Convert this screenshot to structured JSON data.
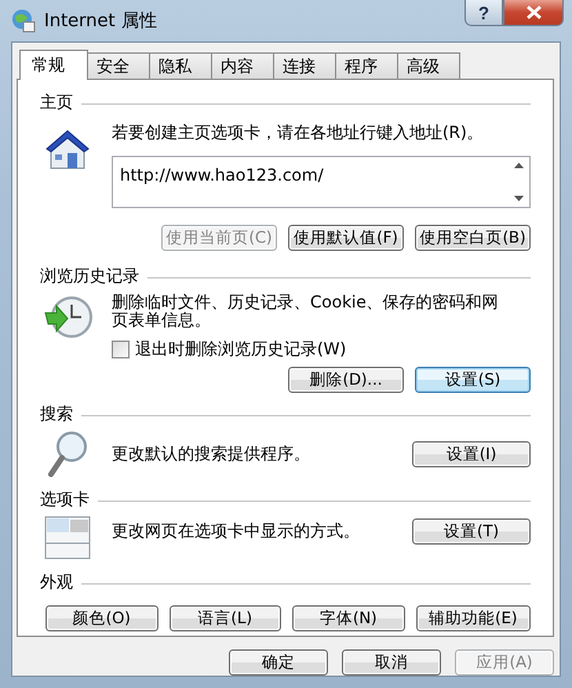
{
  "window": {
    "title": "Internet 属性",
    "help_button": "?"
  },
  "tabs": [
    {
      "label": "常规",
      "selected": true
    },
    {
      "label": "安全",
      "selected": false
    },
    {
      "label": "隐私",
      "selected": false
    },
    {
      "label": "内容",
      "selected": false
    },
    {
      "label": "连接",
      "selected": false
    },
    {
      "label": "程序",
      "selected": false
    },
    {
      "label": "高级",
      "selected": false
    }
  ],
  "homepage": {
    "heading": "主页",
    "description": "若要创建主页选项卡，请在各地址行键入地址(R)。",
    "url": "http://www.hao123.com/",
    "buttons": [
      {
        "label": "使用当前页(C)",
        "disabled": true
      },
      {
        "label": "使用默认值(F)",
        "disabled": false
      },
      {
        "label": "使用空白页(B)",
        "disabled": false
      }
    ]
  },
  "history": {
    "heading": "浏览历史记录",
    "description": "删除临时文件、历史记录、Cookie、保存的密码和网页表单信息。",
    "checkbox": {
      "label": "退出时删除浏览历史记录(W)",
      "checked": false
    },
    "buttons": [
      {
        "label": "删除(D)...",
        "focused": false
      },
      {
        "label": "设置(S)",
        "focused": true
      }
    ]
  },
  "search": {
    "heading": "搜索",
    "description": "更改默认的搜索提供程序。",
    "button": "设置(I)"
  },
  "tab_settings": {
    "heading": "选项卡",
    "description": "更改网页在选项卡中显示的方式。",
    "button": "设置(T)"
  },
  "appearance": {
    "heading": "外观",
    "buttons": [
      "颜色(O)",
      "语言(L)",
      "字体(N)",
      "辅助功能(E)"
    ]
  },
  "footer_buttons": [
    {
      "label": "确定",
      "disabled": false
    },
    {
      "label": "取消",
      "disabled": false
    },
    {
      "label": "应用(A)",
      "disabled": true
    }
  ]
}
